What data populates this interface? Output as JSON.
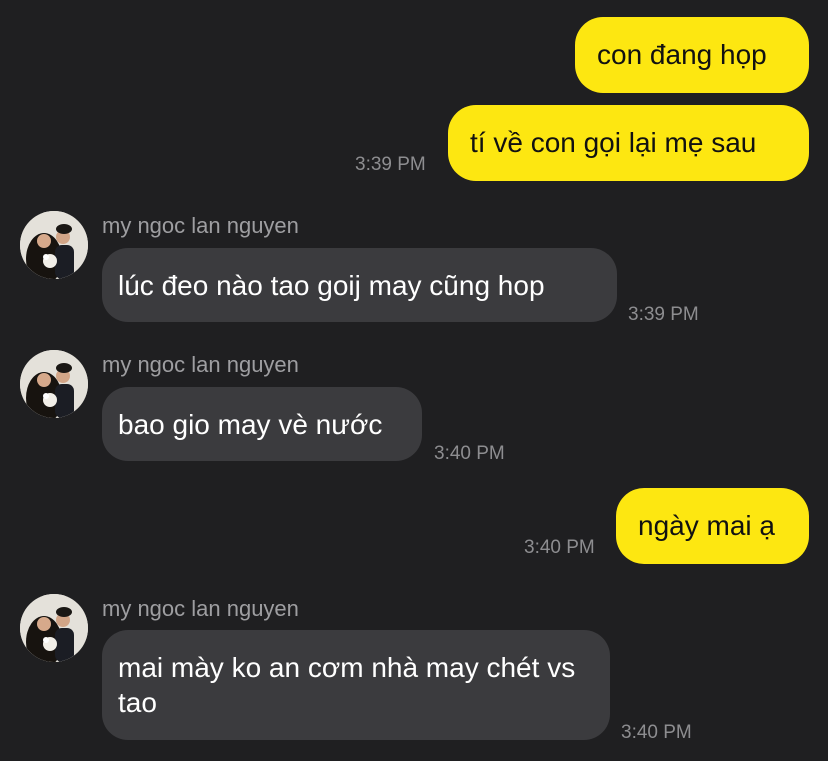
{
  "colors": {
    "background": "#1f1f21",
    "outgoing_bubble": "#fde711",
    "incoming_bubble": "#3b3b3e",
    "timestamp": "#8d8d90"
  },
  "messages": [
    {
      "direction": "outgoing",
      "text": "con đang họp"
    },
    {
      "direction": "outgoing",
      "text": "tí về con gọi lại mẹ sau",
      "time": "3:39 PM"
    },
    {
      "direction": "incoming",
      "sender": "my ngoc lan nguyen",
      "avatar": "profile-photo",
      "text": "lúc đeo nào tao goij may cũng hop",
      "time": "3:39 PM"
    },
    {
      "direction": "incoming",
      "sender": "my ngoc lan nguyen",
      "avatar": "profile-photo",
      "text": "bao gio may vè nước",
      "time": "3:40 PM"
    },
    {
      "direction": "outgoing",
      "text": "ngày mai ạ",
      "time": "3:40 PM"
    },
    {
      "direction": "incoming",
      "sender": "my ngoc lan nguyen",
      "avatar": "profile-photo",
      "text": "mai mày ko an cơm nhà may chét vs tao",
      "time": "3:40 PM"
    }
  ]
}
